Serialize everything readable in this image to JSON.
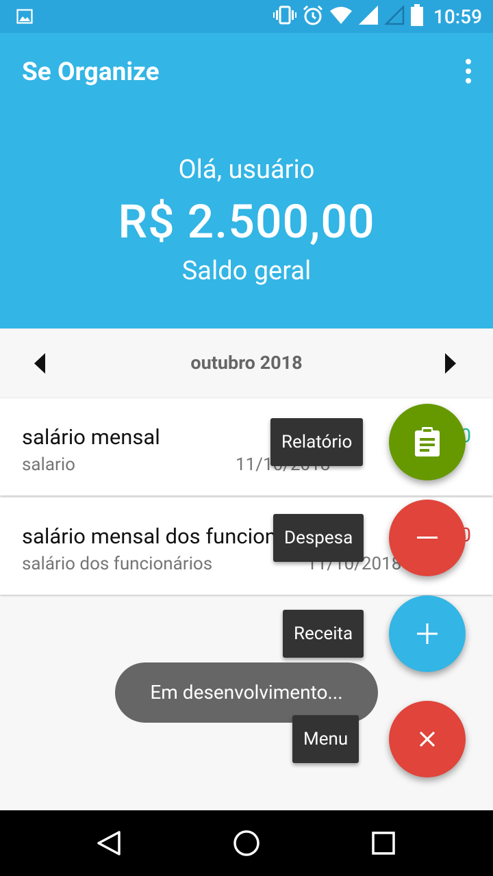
{
  "status_bar": {
    "time": "10:59",
    "icons": [
      "image-icon",
      "vibrate-icon",
      "alarm-icon",
      "wifi-icon",
      "signal-icon",
      "signal-outline-icon",
      "battery-icon"
    ]
  },
  "app_bar": {
    "title": "Se Organize",
    "menu_icon": "more-vert-icon"
  },
  "header": {
    "greeting": "Olá, usuário",
    "balance": "R$ 2.500,00",
    "balance_label": "Saldo geral"
  },
  "month_nav": {
    "label": "outubro 2018"
  },
  "transactions": [
    {
      "title": "salário mensal",
      "category": "salario",
      "date": "11/10/2018",
      "amount": "0"
    },
    {
      "title": "salário mensal dos funcionários",
      "category": "salário dos funcionários",
      "date": "11/10/2018",
      "amount": "0"
    }
  ],
  "fab_menu": {
    "items": [
      {
        "label": "Relatório",
        "icon": "clipboard-icon",
        "color": "#669900"
      },
      {
        "label": "Despesa",
        "icon": "minus-icon",
        "color": "#e0443a"
      },
      {
        "label": "Receita",
        "icon": "plus-icon",
        "color": "#33b5e5"
      }
    ],
    "main": {
      "label": "Menu",
      "icon": "close-icon",
      "color": "#e0443a"
    }
  },
  "toast": {
    "message": "Em desenvolvimento..."
  },
  "colors": {
    "primary": "#33b5e5",
    "status_bar": "#2ba6dc",
    "income_green": "#1bbc9b",
    "expense_red": "#e53935"
  }
}
